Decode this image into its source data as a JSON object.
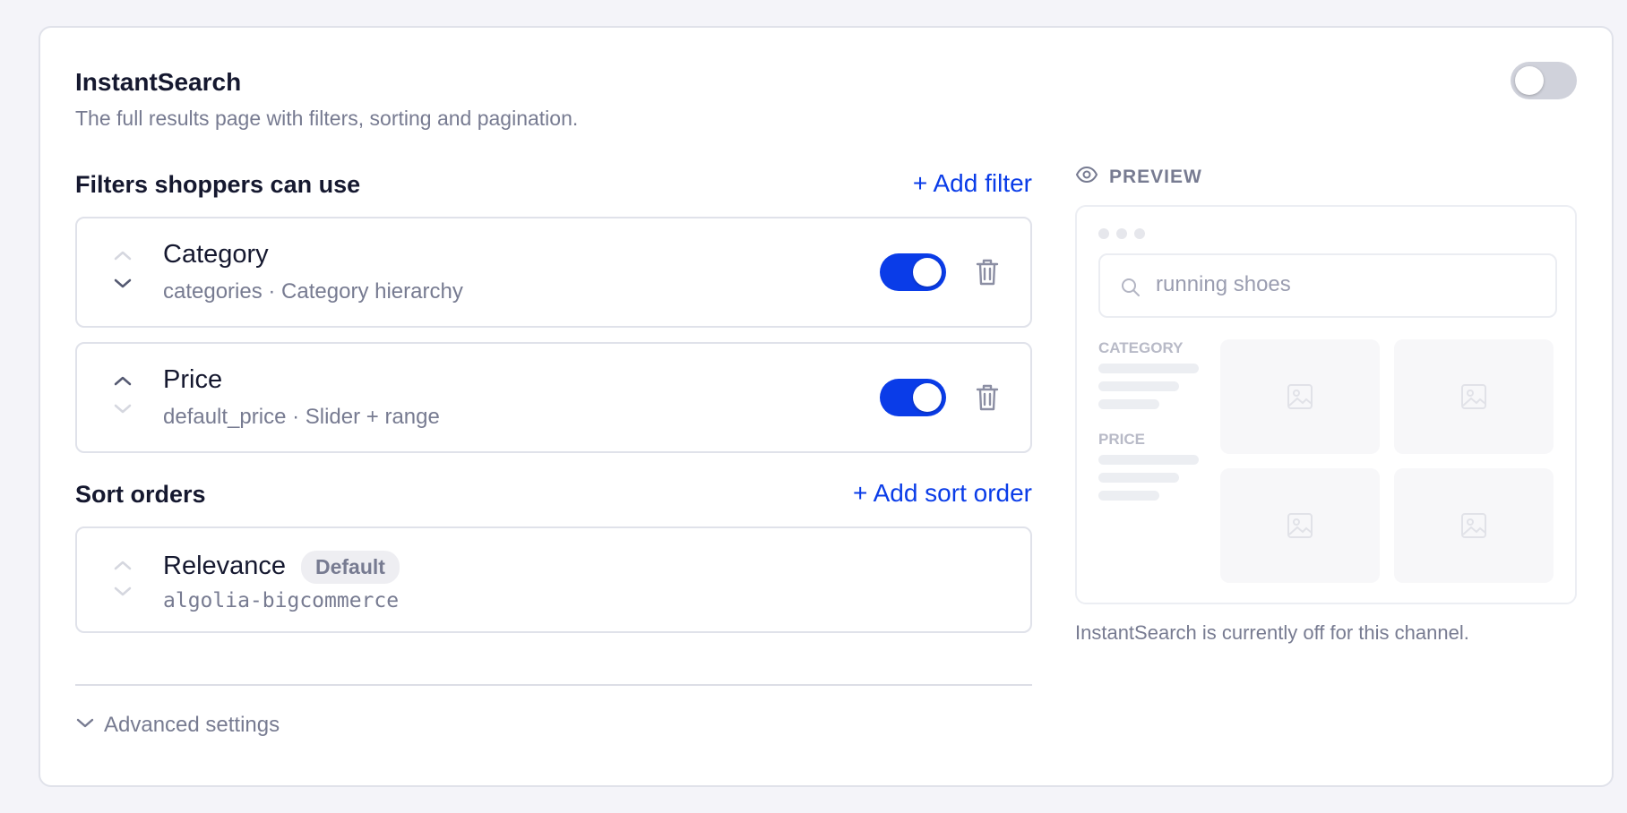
{
  "header": {
    "title": "InstantSearch",
    "subtitle": "The full results page with filters, sorting and pagination.",
    "enabled": false
  },
  "filters": {
    "section_title": "Filters shoppers can use",
    "add_label": "+ Add filter",
    "items": [
      {
        "name": "Category",
        "detail": "categories · Category hierarchy",
        "enabled": true
      },
      {
        "name": "Price",
        "detail": "default_price · Slider + range",
        "enabled": true
      }
    ]
  },
  "sort_orders": {
    "section_title": "Sort orders",
    "add_label": "+ Add sort order",
    "items": [
      {
        "name": "Relevance",
        "badge": "Default",
        "detail": "algolia-bigcommerce"
      }
    ]
  },
  "advanced": {
    "label": "Advanced settings"
  },
  "preview": {
    "label": "PREVIEW",
    "search_value": "running shoes",
    "facet_category": "CATEGORY",
    "facet_price": "PRICE",
    "note": "InstantSearch is currently off for this channel."
  },
  "colors": {
    "accent": "#0a3ce8",
    "toggle_off": "#d0d2db",
    "muted_text": "#777b91"
  },
  "icons": [
    "eye-icon",
    "search-icon",
    "image-icon",
    "trash-icon",
    "chevron-up-icon",
    "chevron-down-icon"
  ]
}
